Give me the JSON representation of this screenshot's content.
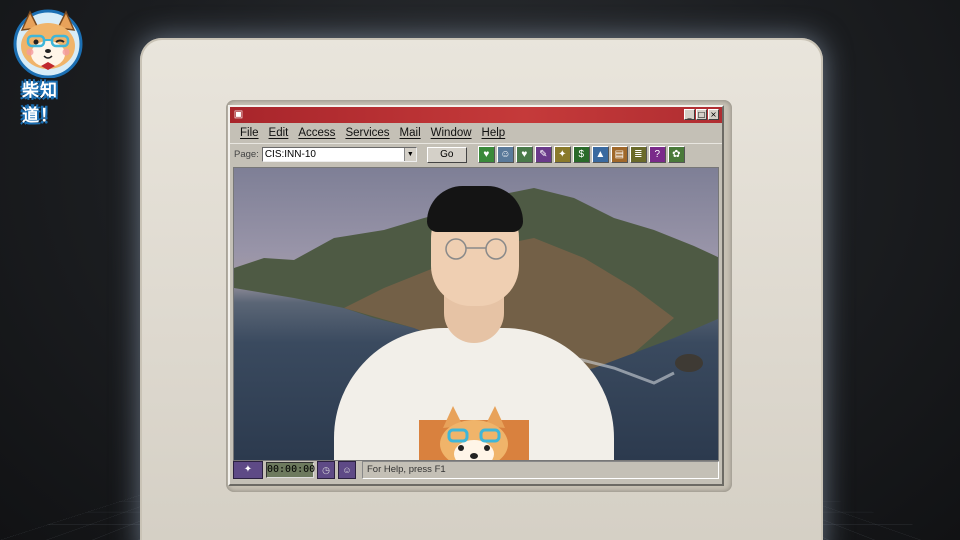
{
  "logo": {
    "text": "柴知道！",
    "icon": "shiba-dog-logo-icon"
  },
  "window": {
    "icon": "app-window-icon",
    "controls": {
      "minimize": "_",
      "maximize": "□",
      "close": "×"
    }
  },
  "menu": {
    "items": [
      {
        "label": "File"
      },
      {
        "label": "Edit"
      },
      {
        "label": "Access"
      },
      {
        "label": "Services"
      },
      {
        "label": "Mail"
      },
      {
        "label": "Window"
      },
      {
        "label": "Help"
      }
    ]
  },
  "toolbar": {
    "page_label": "Page:",
    "page_value": "CIS:INN-10",
    "go_label": "Go",
    "icons": [
      {
        "name": "mail-heart-icon",
        "color": "#3a8a3a",
        "glyph": "♥"
      },
      {
        "name": "people-icon",
        "color": "#5a7a9a",
        "glyph": "☺"
      },
      {
        "name": "heart-icon",
        "color": "#4a7a4a",
        "glyph": "♥"
      },
      {
        "name": "pencil-icon",
        "color": "#6a3a8a",
        "glyph": "✎"
      },
      {
        "name": "star-icon",
        "color": "#8a7a2a",
        "glyph": "✦"
      },
      {
        "name": "money-icon",
        "color": "#2a6a2a",
        "glyph": "$"
      },
      {
        "name": "landscape-icon",
        "color": "#3a6aa0",
        "glyph": "▲"
      },
      {
        "name": "books-icon",
        "color": "#a0682a",
        "glyph": "▤"
      },
      {
        "name": "checklist-icon",
        "color": "#6a6a2a",
        "glyph": "≣"
      },
      {
        "name": "question-icon",
        "color": "#7a2a8a",
        "glyph": "?"
      },
      {
        "name": "map-icon",
        "color": "#4a7a3a",
        "glyph": "✿"
      }
    ]
  },
  "status": {
    "left_icon": "globe-icon",
    "timer": "00:00:00",
    "help_text": "For Help, press F1"
  },
  "colors": {
    "titlebar": "#b02d31",
    "window_bg": "#c4c0b6",
    "monitor": "#e6e2d9"
  }
}
